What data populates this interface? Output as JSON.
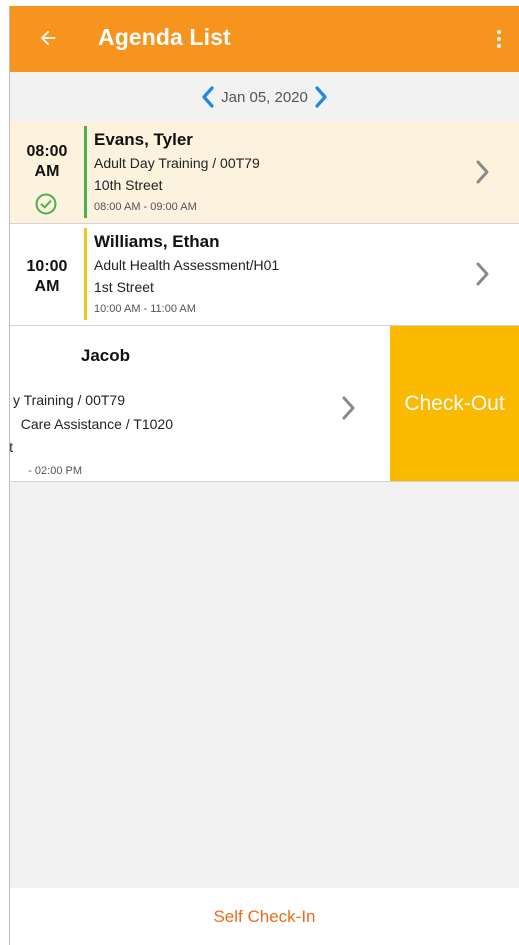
{
  "app_bar": {
    "title": "Agenda List",
    "background": "#f7941d"
  },
  "date_nav": {
    "date": "Jan 05, 2020",
    "chevron_color": "#1e88e5"
  },
  "appointments": [
    {
      "time": "08:00\nAM",
      "status_icon": "check-circle-icon",
      "status_color": "#4caf50",
      "name": "Evans, Tyler",
      "services": [
        "Adult Day Training / 00T79"
      ],
      "address": "10th Street",
      "timespan": "08:00 AM - 09:00 AM",
      "accent": "#4caf50",
      "highlight": "#fdf2de"
    },
    {
      "time": "10:00\nAM",
      "name": "Williams, Ethan",
      "services": [
        "Adult Health Assessment/H01"
      ],
      "address": "1st Street",
      "timespan": "10:00 AM - 11:00 AM",
      "accent": "#f6c31b"
    },
    {
      "name_visible": "Jacob",
      "services_visible": [
        "y Training / 00T79",
        " Care Assistance / T1020"
      ],
      "address_visible": "t",
      "timespan_visible": "- 02:00 PM",
      "action_label": "Check-Out",
      "action_color": "#fbb900"
    }
  ],
  "footer": {
    "self_checkin_label": "Self Check-In",
    "color": "#ea6d1a"
  }
}
